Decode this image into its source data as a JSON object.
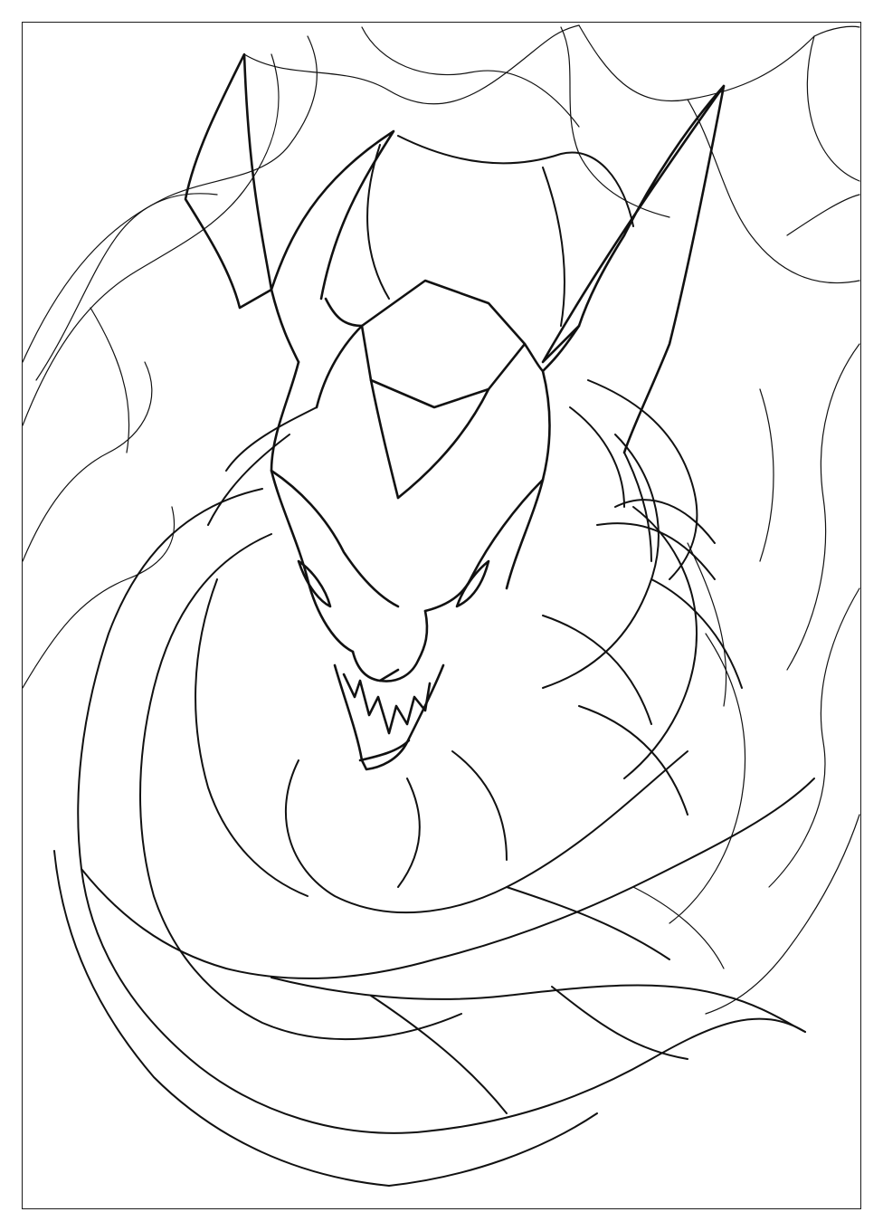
{
  "artwork": {
    "style": "black line-art coloring page",
    "subject_icon": "dragon-icon",
    "colors": {
      "background": "#ffffff",
      "ink": "#111111"
    }
  }
}
